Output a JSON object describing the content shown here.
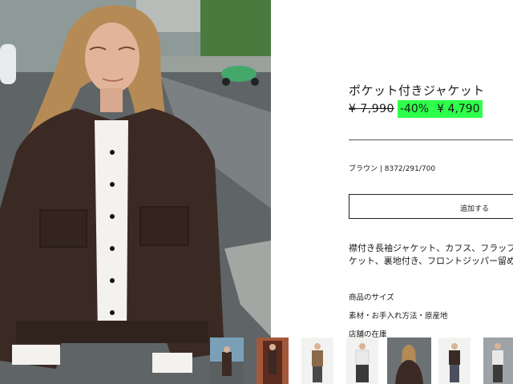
{
  "product": {
    "title": "ポケット付きジャケット",
    "old_price": "¥ 7,990",
    "discount": "-40%",
    "sale_price": "¥ 4,790",
    "color_ref": "ブラウン | 8372/291/700",
    "add_button_label": "追加する",
    "description_line1": "襟付き長袖ジャケット、カフス、フラップ",
    "description_line2": "ケット、裏地付き、フロントジッパー留め"
  },
  "links": {
    "size": "商品のサイズ",
    "materials": "素材・お手入れ方法・原産地",
    "store_stock": "店舗の在庫"
  },
  "colors": {
    "sale_highlight": "#2dff4b",
    "jacket": "#3b2a24",
    "text": "#1a1a1a"
  },
  "thumbnails": [
    {
      "name": "thumb-street-view"
    },
    {
      "name": "thumb-doorway"
    },
    {
      "name": "thumb-model-front"
    },
    {
      "name": "thumb-model-white-top"
    },
    {
      "name": "thumb-model-closeup"
    },
    {
      "name": "thumb-model-side"
    },
    {
      "name": "thumb-model-back"
    }
  ]
}
